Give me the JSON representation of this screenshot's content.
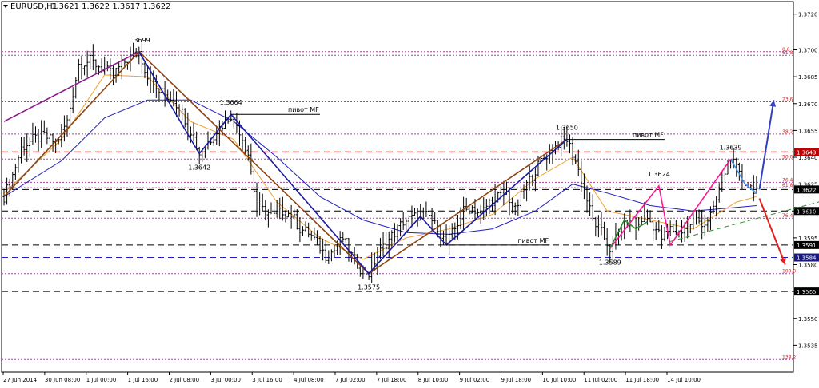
{
  "header": {
    "symbol": "EURUSD,H1",
    "quote": "1.3621 1.3622 1.3617 1.3622",
    "menu_arrow": "triangle-down-icon"
  },
  "colors": {
    "background": "#ffffff",
    "candle": "#000000",
    "ma_fast": "#f0a030",
    "ma_slow": "#2020c0",
    "fib_level": "#a040a0",
    "fib_text": "#c03030",
    "red_dash": "#c00000",
    "black_dash": "#000000",
    "blue_dash": "#2020c0",
    "zz_brown": "#8b4513",
    "zz_blue": "#1a1aa0",
    "zz_purple": "#8b1a8b",
    "zz_pink": "#ff1493",
    "zz_green": "#2e8b2e",
    "zz_light_blue": "#4a90e2",
    "arrow_up": "#3040c0",
    "arrow_down": "#e02020",
    "trend_green": "#2e8b2e",
    "price_box": "#000000",
    "price_box_red": "#c00000",
    "price_box_blue": "#1a1a80"
  },
  "chart_data": {
    "type": "candlestick",
    "symbol": "EURUSD",
    "timeframe": "H1",
    "ylim": [
      1.352,
      1.3727
    ],
    "y_ticks": [
      1.372,
      1.37,
      1.3685,
      1.367,
      1.3655,
      1.364,
      1.3625,
      1.361,
      1.3595,
      1.358,
      1.3565,
      1.355,
      1.3535
    ],
    "x_ticks": [
      "27 Jun 2014",
      "30 Jun 08:00",
      "1 Jul 00:00",
      "1 Jul 16:00",
      "2 Jul 08:00",
      "3 Jul 00:00",
      "3 Jul 16:00",
      "4 Jul 08:00",
      "7 Jul 02:00",
      "7 Jul 18:00",
      "8 Jul 10:00",
      "9 Jul 02:00",
      "9 Jul 18:00",
      "10 Jul 10:00",
      "11 Jul 02:00",
      "11 Jul 18:00",
      "14 Jul 10:00"
    ],
    "price_path": [
      [
        0,
        1.3618
      ],
      [
        3,
        1.363
      ],
      [
        6,
        1.3645
      ],
      [
        10,
        1.365
      ],
      [
        14,
        1.3652
      ],
      [
        18,
        1.3648
      ],
      [
        22,
        1.366
      ],
      [
        26,
        1.3692
      ],
      [
        30,
        1.3694
      ],
      [
        34,
        1.369
      ],
      [
        38,
        1.3686
      ],
      [
        41,
        1.3692
      ],
      [
        44,
        1.3696
      ],
      [
        47,
        1.3699
      ],
      [
        50,
        1.3685
      ],
      [
        53,
        1.3678
      ],
      [
        56,
        1.3675
      ],
      [
        59,
        1.3672
      ],
      [
        62,
        1.3665
      ],
      [
        65,
        1.3655
      ],
      [
        68,
        1.3642
      ],
      [
        71,
        1.3648
      ],
      [
        74,
        1.3655
      ],
      [
        77,
        1.366
      ],
      [
        79,
        1.3664
      ],
      [
        82,
        1.3655
      ],
      [
        85,
        1.3642
      ],
      [
        88,
        1.3612
      ],
      [
        91,
        1.361
      ],
      [
        94,
        1.3607
      ],
      [
        97,
        1.361
      ],
      [
        100,
        1.3608
      ],
      [
        103,
        1.36
      ],
      [
        106,
        1.3598
      ],
      [
        109,
        1.3592
      ],
      [
        112,
        1.3585
      ],
      [
        115,
        1.3588
      ],
      [
        118,
        1.3595
      ],
      [
        121,
        1.3585
      ],
      [
        124,
        1.3578
      ],
      [
        127,
        1.3575
      ],
      [
        130,
        1.3585
      ],
      [
        133,
        1.3592
      ],
      [
        136,
        1.3598
      ],
      [
        139,
        1.3604
      ],
      [
        142,
        1.3606
      ],
      [
        145,
        1.3608
      ],
      [
        148,
        1.3607
      ],
      [
        151,
        1.36
      ],
      [
        154,
        1.3592
      ],
      [
        157,
        1.36
      ],
      [
        160,
        1.361
      ],
      [
        163,
        1.3612
      ],
      [
        166,
        1.3608
      ],
      [
        169,
        1.3615
      ],
      [
        172,
        1.3618
      ],
      [
        175,
        1.362
      ],
      [
        178,
        1.361
      ],
      [
        181,
        1.3622
      ],
      [
        184,
        1.363
      ],
      [
        187,
        1.3638
      ],
      [
        190,
        1.3643
      ],
      [
        193,
        1.3648
      ],
      [
        196,
        1.365
      ],
      [
        199,
        1.3638
      ],
      [
        202,
        1.3622
      ],
      [
        205,
        1.3605
      ],
      [
        208,
        1.3598
      ],
      [
        211,
        1.3589
      ],
      [
        214,
        1.3598
      ],
      [
        217,
        1.3604
      ],
      [
        220,
        1.36
      ],
      [
        223,
        1.3608
      ],
      [
        226,
        1.3602
      ],
      [
        229,
        1.3595
      ],
      [
        232,
        1.36
      ],
      [
        235,
        1.3598
      ],
      [
        238,
        1.3602
      ],
      [
        241,
        1.3605
      ],
      [
        244,
        1.3603
      ],
      [
        247,
        1.361
      ],
      [
        250,
        1.3628
      ],
      [
        253,
        1.3639
      ],
      [
        256,
        1.363
      ],
      [
        259,
        1.3624
      ],
      [
        262,
        1.3622
      ]
    ],
    "ma_fast_path": [
      [
        0,
        1.362
      ],
      [
        20,
        1.365
      ],
      [
        35,
        1.3686
      ],
      [
        50,
        1.3685
      ],
      [
        65,
        1.366
      ],
      [
        80,
        1.365
      ],
      [
        95,
        1.3615
      ],
      [
        110,
        1.3595
      ],
      [
        125,
        1.3583
      ],
      [
        140,
        1.3595
      ],
      [
        155,
        1.36
      ],
      [
        170,
        1.3608
      ],
      [
        185,
        1.3628
      ],
      [
        198,
        1.364
      ],
      [
        210,
        1.361
      ],
      [
        225,
        1.3605
      ],
      [
        240,
        1.36
      ],
      [
        255,
        1.3615
      ],
      [
        262,
        1.3618
      ]
    ],
    "ma_slow_path": [
      [
        0,
        1.3618
      ],
      [
        20,
        1.3638
      ],
      [
        35,
        1.3662
      ],
      [
        50,
        1.3672
      ],
      [
        65,
        1.3672
      ],
      [
        80,
        1.366
      ],
      [
        95,
        1.364
      ],
      [
        110,
        1.3618
      ],
      [
        125,
        1.3605
      ],
      [
        140,
        1.3598
      ],
      [
        155,
        1.3597
      ],
      [
        170,
        1.36
      ],
      [
        185,
        1.361
      ],
      [
        198,
        1.3625
      ],
      [
        210,
        1.362
      ],
      [
        225,
        1.3613
      ],
      [
        240,
        1.361
      ],
      [
        255,
        1.3612
      ],
      [
        262,
        1.3613
      ]
    ],
    "fib_levels": [
      {
        "label": "0.0",
        "price": 1.3699
      },
      {
        "label": "61.8",
        "price": 1.3697
      },
      {
        "label": "23.6",
        "price": 1.3671
      },
      {
        "label": "38.2",
        "price": 1.3653
      },
      {
        "label": "50.0",
        "price": 1.3639
      },
      {
        "label": "76.4",
        "price": 1.3626
      },
      {
        "label": "61.8",
        "price": 1.3623
      },
      {
        "label": "76.4",
        "price": 1.3606
      },
      {
        "label": "100.0",
        "price": 1.3575
      },
      {
        "label": "138.2",
        "price": 1.3527
      }
    ],
    "horizontal_lines": [
      {
        "price": 1.3643,
        "style": "red_dash",
        "label": "1.3643"
      },
      {
        "price": 1.3622,
        "style": "black_dash",
        "label": "1.3622"
      },
      {
        "price": 1.361,
        "style": "black_dash",
        "label": "1.3610"
      },
      {
        "price": 1.3591,
        "style": "black_dash",
        "label": "1.3591"
      },
      {
        "price": 1.3584,
        "style": "blue_dash",
        "label": "1.3584"
      },
      {
        "price": 1.3565,
        "style": "black_dash",
        "label": "1.3565"
      }
    ],
    "zigzags": [
      {
        "color": "zz_purple",
        "points": [
          [
            0,
            1.366
          ],
          [
            47,
            1.3699
          ]
        ]
      },
      {
        "color": "zz_brown",
        "points": [
          [
            0,
            1.3618
          ],
          [
            47,
            1.3699
          ],
          [
            127,
            1.3575
          ],
          [
            196,
            1.365
          ]
        ]
      },
      {
        "color": "zz_blue",
        "points": [
          [
            47,
            1.3699
          ],
          [
            68,
            1.3642
          ],
          [
            79,
            1.3664
          ],
          [
            127,
            1.3575
          ],
          [
            145,
            1.3607
          ],
          [
            154,
            1.3591
          ],
          [
            196,
            1.365
          ]
        ]
      },
      {
        "color": "zz_pink",
        "points": [
          [
            211,
            1.3589
          ],
          [
            228,
            1.3624
          ],
          [
            232,
            1.3591
          ],
          [
            253,
            1.3639
          ]
        ]
      },
      {
        "color": "zz_green",
        "points": [
          [
            211,
            1.3589
          ],
          [
            216,
            1.3605
          ],
          [
            220,
            1.36
          ],
          [
            224,
            1.3604
          ]
        ]
      },
      {
        "color": "zz_light_blue",
        "points": [
          [
            253,
            1.3639
          ],
          [
            258,
            1.3625
          ],
          [
            262,
            1.362
          ]
        ]
      }
    ],
    "trend_line": {
      "points": [
        [
          232,
          1.3593
        ],
        [
          300,
          1.3622
        ]
      ]
    },
    "pivot_labels": [
      {
        "text": "пивот MF",
        "price": 1.3664,
        "bar_from": 79,
        "bar_to": 110
      },
      {
        "text": "пивот MF",
        "price": 1.365,
        "bar_from": 196,
        "bar_to": 230
      },
      {
        "text": "пивот MF",
        "price": 1.3591,
        "bar_from": 154,
        "bar_to": 190
      }
    ],
    "swing_labels": [
      {
        "text": "1.3699",
        "bar": 47,
        "price": 1.3699,
        "pos": "above"
      },
      {
        "text": "1.3664",
        "bar": 79,
        "price": 1.3664,
        "pos": "above"
      },
      {
        "text": "1.3642",
        "bar": 68,
        "price": 1.3642,
        "pos": "below"
      },
      {
        "text": "1.3650",
        "bar": 196,
        "price": 1.365,
        "pos": "above"
      },
      {
        "text": "1.3624",
        "bar": 228,
        "price": 1.3624,
        "pos": "above"
      },
      {
        "text": "1.3639",
        "bar": 253,
        "price": 1.3639,
        "pos": "above"
      },
      {
        "text": "1.3589",
        "bar": 211,
        "price": 1.3589,
        "pos": "below"
      },
      {
        "text": "1.3575",
        "bar": 127,
        "price": 1.3575,
        "pos": "below"
      }
    ],
    "arrows": [
      {
        "color": "arrow_up",
        "from": [
          263,
          1.3622
        ],
        "to": [
          268,
          1.3672
        ]
      },
      {
        "color": "arrow_down",
        "from": [
          263,
          1.3617
        ],
        "to": [
          272,
          1.358
        ]
      }
    ]
  }
}
